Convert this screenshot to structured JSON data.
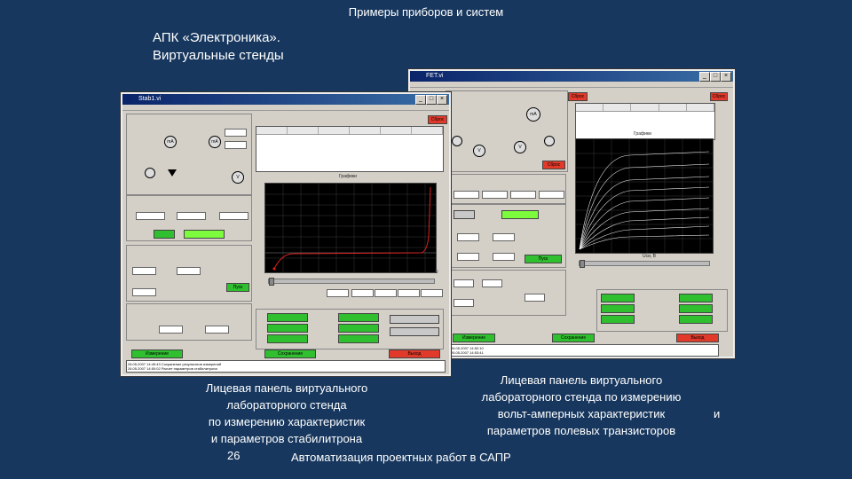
{
  "slide": {
    "top_title": "Примеры приборов и систем",
    "heading_line1": "АПК «Электроника».",
    "heading_line2": "Виртуальные стенды",
    "caption_left": [
      "Лицевая панель виртуального",
      "лабораторного стенда",
      "по измерению характеристик",
      "и параметров стабилитрона"
    ],
    "caption_right": [
      "Лицевая панель виртуального",
      "лабораторного стенда по измерению",
      "вольт-амперных характеристик",
      "параметров полевых транзисторов"
    ],
    "caption_right_and": "и",
    "page_number": "26",
    "footer_text": "Автоматизация проектных работ в САПР"
  },
  "colors": {
    "background": "#17375e",
    "panel": "#d4d0c8",
    "titlebar": "#0a246a",
    "button_green": "#2fbf2f",
    "button_red": "#e23a2a",
    "curve": "#e02020"
  },
  "window_zener": {
    "title": "Stab1.vi",
    "buttons": {
      "clear": "Сброс",
      "start": "Пуск",
      "stop": "Стоп",
      "measure": "Измерение",
      "save": "Сохранение",
      "exit": "Выход"
    },
    "labels": {
      "x_axis": "U",
      "graph_title": "Графики"
    },
    "log_lines": [
      "26.05.2007 14:49:43 Сохранение результатов измерений",
      "26.05.2007 14:50:02 Расчет параметров стабилитрона"
    ]
  },
  "window_fet": {
    "title": "FET.vi",
    "buttons": {
      "clear": "Сброс",
      "start": "Пуск",
      "measure": "Измерение",
      "save": "Сохранение",
      "exit": "Выход"
    },
    "labels": {
      "graph_title": "Графики",
      "x_axis": "Uси, В"
    },
    "log_lines": [
      "26.05.2007 14:52:10",
      "26.05.2007 14:53:41"
    ]
  }
}
